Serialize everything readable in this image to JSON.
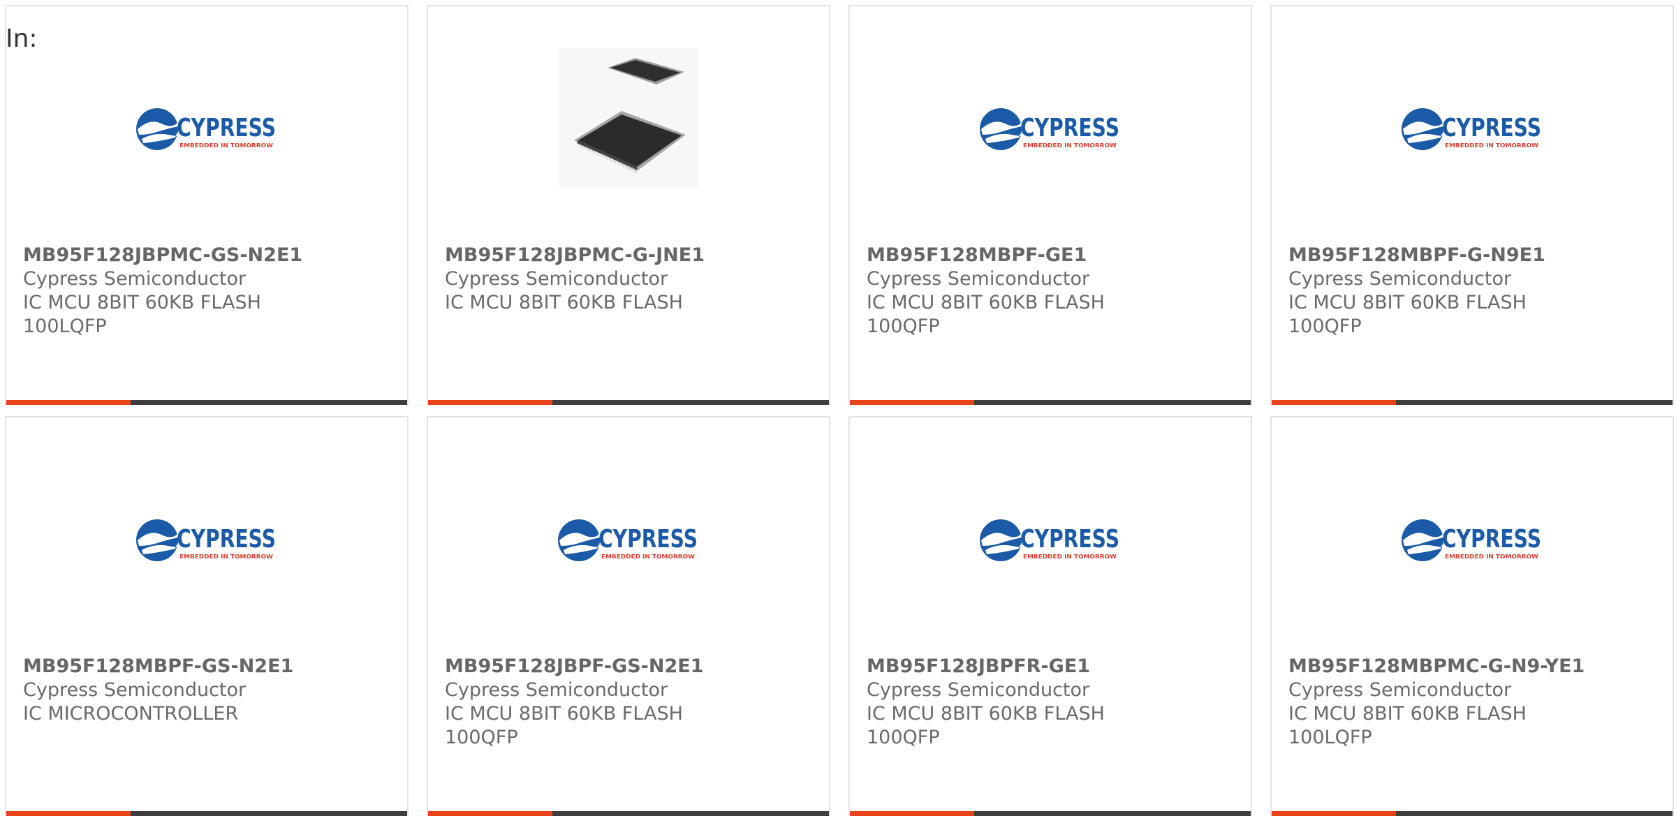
{
  "header": {
    "in_label": "In:"
  },
  "colors": {
    "accent": "#e8431b",
    "bar_dark": "#3e3e3e",
    "card_border": "#e3e3e3",
    "cypress_blue": "#1b5aa6",
    "cypress_red": "#d6402e"
  },
  "logo": {
    "name": "CYPRESS",
    "tagline": "EMBEDDED IN TOMORROW"
  },
  "cards": [
    {
      "part_number": "MB95F128JBPMC-GS-N2E1",
      "manufacturer": "Cypress Semiconductor",
      "desc_line1": "IC MCU 8BIT 60KB FLASH",
      "desc_line2": "100LQFP",
      "image": "cypress-logo-icon",
      "accent_fraction": 0.31
    },
    {
      "part_number": "MB95F128JBPMC-G-JNE1",
      "manufacturer": "Cypress Semiconductor",
      "desc_line1": "IC MCU 8BIT 60KB FLASH",
      "desc_line2": "",
      "image": "ic-chip-icon",
      "accent_fraction": 0.31
    },
    {
      "part_number": "MB95F128MBPF-GE1",
      "manufacturer": "Cypress Semiconductor",
      "desc_line1": "IC MCU 8BIT 60KB FLASH",
      "desc_line2": "100QFP",
      "image": "cypress-logo-icon",
      "accent_fraction": 0.31
    },
    {
      "part_number": "MB95F128MBPF-G-N9E1",
      "manufacturer": "Cypress Semiconductor",
      "desc_line1": "IC MCU 8BIT 60KB FLASH",
      "desc_line2": "100QFP",
      "image": "cypress-logo-icon",
      "accent_fraction": 0.31
    },
    {
      "part_number": "MB95F128MBPF-GS-N2E1",
      "manufacturer": "Cypress Semiconductor",
      "desc_line1": "IC MICROCONTROLLER",
      "desc_line2": "",
      "image": "cypress-logo-icon",
      "accent_fraction": 0.31
    },
    {
      "part_number": "MB95F128JBPF-GS-N2E1",
      "manufacturer": "Cypress Semiconductor",
      "desc_line1": "IC MCU 8BIT 60KB FLASH",
      "desc_line2": "100QFP",
      "image": "cypress-logo-icon",
      "accent_fraction": 0.31
    },
    {
      "part_number": "MB95F128JBPFR-GE1",
      "manufacturer": "Cypress Semiconductor",
      "desc_line1": "IC MCU 8BIT 60KB FLASH",
      "desc_line2": "100QFP",
      "image": "cypress-logo-icon",
      "accent_fraction": 0.31
    },
    {
      "part_number": "MB95F128MBPMC-G-N9-YE1",
      "manufacturer": "Cypress Semiconductor",
      "desc_line1": "IC MCU 8BIT 60KB FLASH",
      "desc_line2": "100LQFP",
      "image": "cypress-logo-icon",
      "accent_fraction": 0.31
    }
  ]
}
